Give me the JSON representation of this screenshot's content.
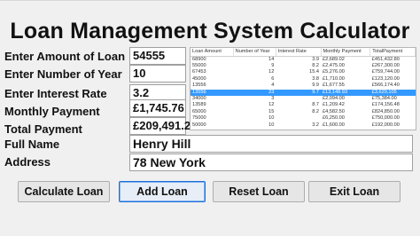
{
  "title": "Loan Management System Calculator",
  "labels": {
    "loan_amount": "Enter Amount of Loan",
    "years": "Enter Number of Year",
    "rate": "Enter Interest Rate",
    "monthly": "Monthly Payment",
    "total": "Total Payment",
    "name": "Full Name",
    "address": "Address"
  },
  "fields": {
    "loan_amount": "54555",
    "years": "10",
    "rate": "3.2",
    "monthly": "£1,745.76",
    "total": "£209,491.20",
    "name": "Henry Hill",
    "address": "78 New York"
  },
  "grid": {
    "headers": [
      "Loan Amount",
      "Number of Year",
      "Interest Rate",
      "Monthly Payment",
      "TotalPayment"
    ],
    "rows": [
      [
        "68900",
        "14",
        "3.9",
        "£2,689.02",
        "£451,432.80"
      ],
      [
        "55000",
        "9",
        "8.2",
        "£2,475.00",
        "£267,300.00"
      ],
      [
        "67453",
        "12",
        "15.4",
        "£5,276.00",
        "£759,744.00"
      ],
      [
        "45000",
        "6",
        "3.8",
        "£1,710.00",
        "£123,120.00"
      ],
      [
        "13556",
        "4",
        "9.9",
        "£1,677.55",
        "£566,174.40"
      ],
      [
        "13556",
        "23",
        "9.7",
        "£13,148.93",
        "£3,629,105"
      ],
      [
        "34000",
        "3",
        "",
        "£2,094.00",
        "£75,384.00"
      ],
      [
        "13589",
        "12",
        "8.7",
        "£1,209.42",
        "£174,156.48"
      ],
      [
        "65000",
        "15",
        "8.2",
        "£4,582.50",
        "£824,850.00"
      ],
      [
        "75000",
        "10",
        "",
        "£6,250.00",
        "£750,000.00"
      ],
      [
        "50000",
        "10",
        "3.2",
        "£1,600.00",
        "£192,000.00"
      ]
    ],
    "selected_index": 5
  },
  "buttons": {
    "calculate": "Calculate Loan",
    "add": "Add Loan",
    "reset": "Reset Loan",
    "exit": "Exit Loan"
  }
}
